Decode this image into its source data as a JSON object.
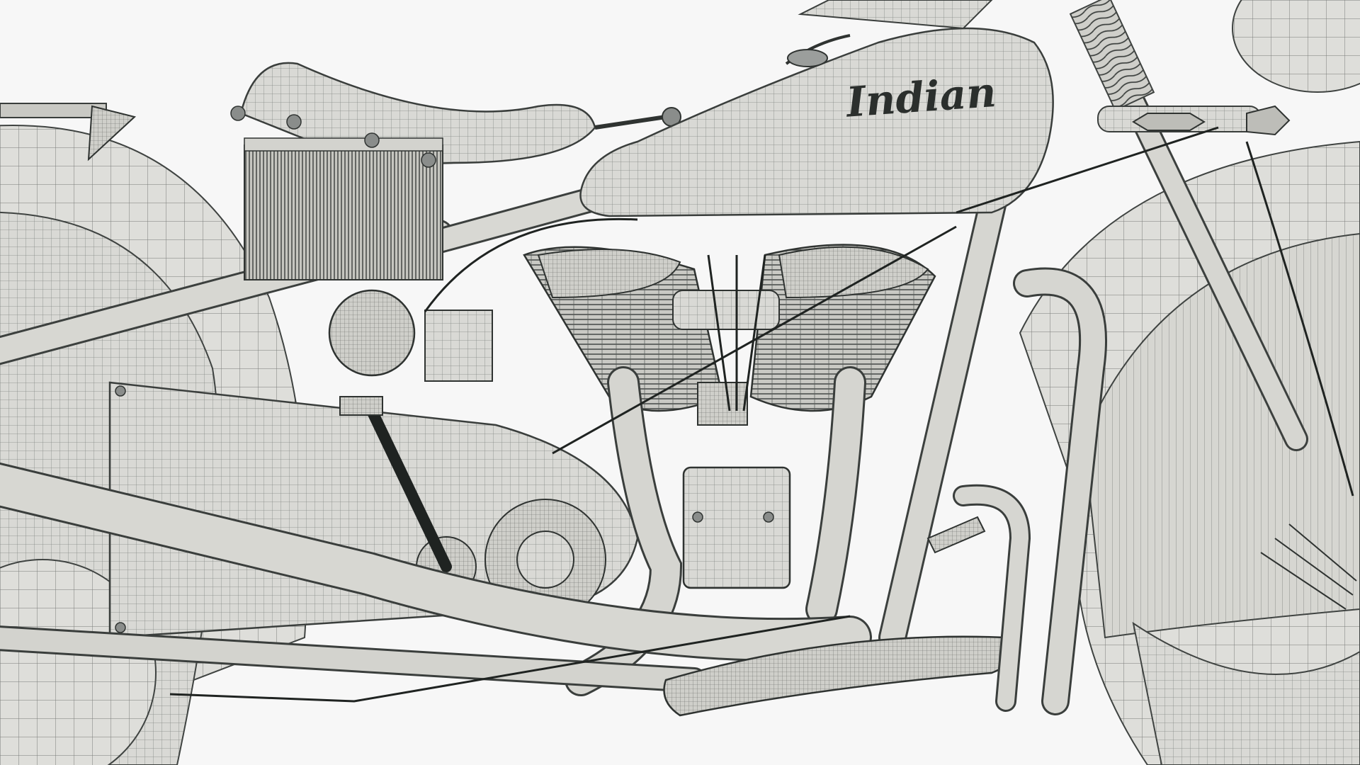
{
  "render": {
    "brand_script": "Indian"
  }
}
